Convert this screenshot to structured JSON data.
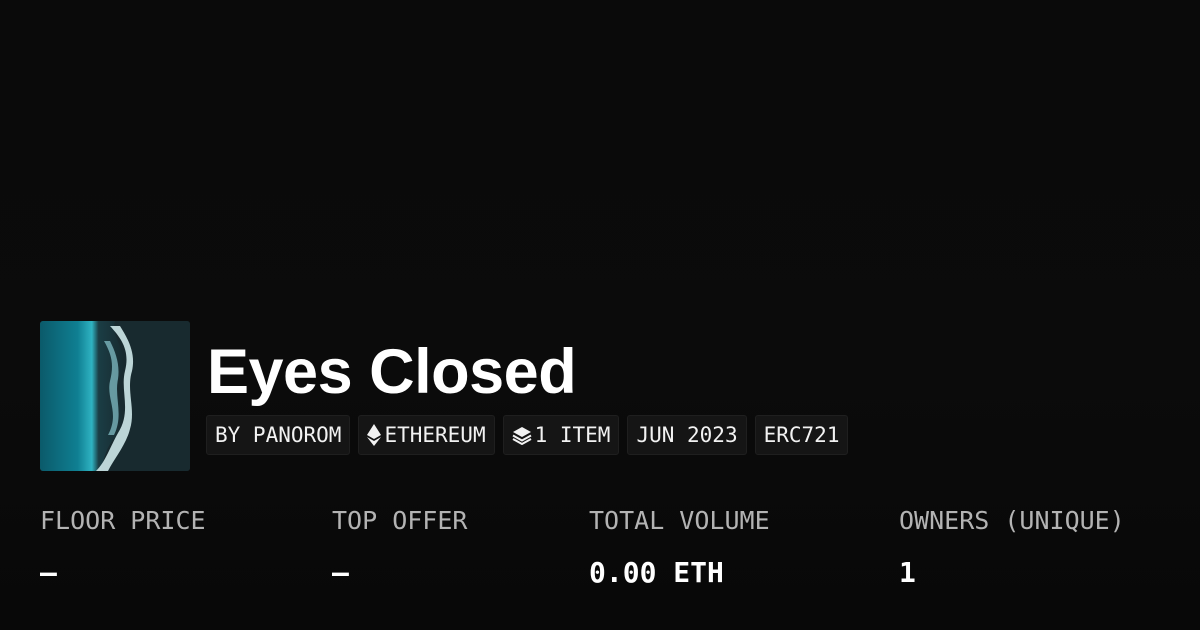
{
  "collection": {
    "title": "Eyes Closed",
    "thumbnail_alt": "ocean-wave-thumbnail"
  },
  "tags": [
    {
      "label": "BY PANOROM",
      "icon": ""
    },
    {
      "label": "ETHEREUM",
      "icon": "ethereum-icon"
    },
    {
      "label": "1 ITEM",
      "icon": "layers-icon"
    },
    {
      "label": "JUN 2023",
      "icon": ""
    },
    {
      "label": "ERC721",
      "icon": ""
    }
  ],
  "stats": [
    {
      "label": "FLOOR PRICE",
      "value": "—"
    },
    {
      "label": "TOP OFFER",
      "value": "—"
    },
    {
      "label": "TOTAL VOLUME",
      "value": "0.00 ETH"
    },
    {
      "label": "OWNERS (UNIQUE)",
      "value": "1"
    }
  ],
  "colors": {
    "background": "#0a0a0a",
    "tag_background": "#151515",
    "label_gray": "#b3b3b3",
    "text": "#ffffff"
  }
}
